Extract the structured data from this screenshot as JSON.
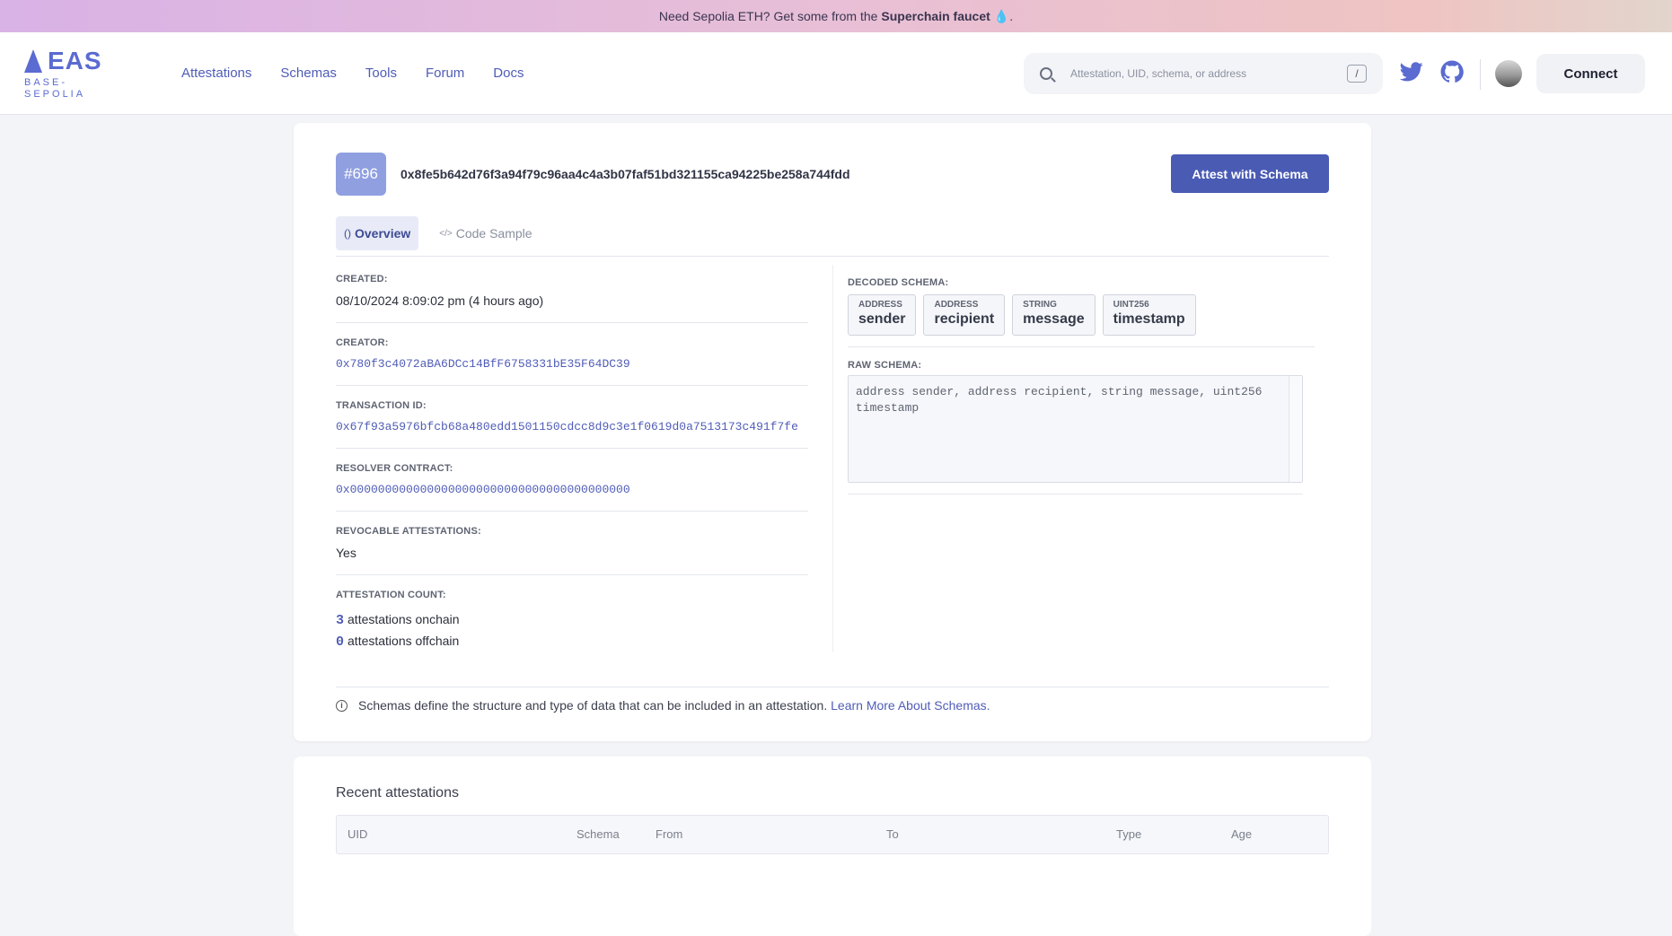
{
  "banner": {
    "text": "Need Sepolia ETH? Get some from the",
    "link": "Superchain faucet",
    "suffix": "."
  },
  "logo": {
    "brand": "EAS",
    "network": "BASE-SEPOLIA"
  },
  "nav": {
    "items": [
      "Attestations",
      "Schemas",
      "Tools",
      "Forum",
      "Docs"
    ]
  },
  "search": {
    "placeholder": "Attestation, UID, schema, or address",
    "shortcut": "/"
  },
  "header": {
    "connect_label": "Connect"
  },
  "schema": {
    "number": "#696",
    "uid": "0x8fe5b642d76f3a94f79c96aa4c4a3b07faf51bd321155ca94225be258a744fdd",
    "attest_label": "Attest with Schema"
  },
  "tabs": [
    {
      "icon": "()",
      "label": "Overview"
    },
    {
      "icon": "</>",
      "label": "Code Sample"
    }
  ],
  "fields": {
    "created_label": "CREATED:",
    "created": "08/10/2024 8:09:02 pm (4 hours ago)",
    "creator_label": "CREATOR:",
    "creator": "0x780f3c4072aBA6DCc14BfF6758331bE35F64DC39",
    "tx_label": "TRANSACTION ID:",
    "tx": "0x67f93a5976bfcb68a480edd1501150cdcc8d9c3e1f0619d0a7513173c491f7fe",
    "resolver_label": "RESOLVER CONTRACT:",
    "resolver": "0x0000000000000000000000000000000000000000",
    "revocable_label": "REVOCABLE ATTESTATIONS:",
    "revocable": "Yes",
    "count_label": "ATTESTATION COUNT:",
    "onchain_count": "3",
    "onchain_text": "attestations onchain",
    "offchain_count": "0",
    "offchain_text": "attestations offchain"
  },
  "decoded": {
    "label": "DECODED SCHEMA:",
    "items": [
      {
        "type": "ADDRESS",
        "name": "sender"
      },
      {
        "type": "ADDRESS",
        "name": "recipient"
      },
      {
        "type": "STRING",
        "name": "message"
      },
      {
        "type": "UINT256",
        "name": "timestamp"
      }
    ]
  },
  "raw": {
    "label": "RAW SCHEMA:",
    "text": "address sender, address recipient, string message, uint256 timestamp"
  },
  "info": {
    "text": "Schemas define the structure and type of data that can be included in an attestation.",
    "link": "Learn More About Schemas."
  },
  "recent": {
    "title": "Recent attestations",
    "columns": [
      "UID",
      "Schema",
      "From",
      "To",
      "Type",
      "Age"
    ]
  },
  "colors": {
    "accent": "#4a5bb4",
    "badge": "#8f9fe0",
    "link": "#4f5cb7"
  }
}
